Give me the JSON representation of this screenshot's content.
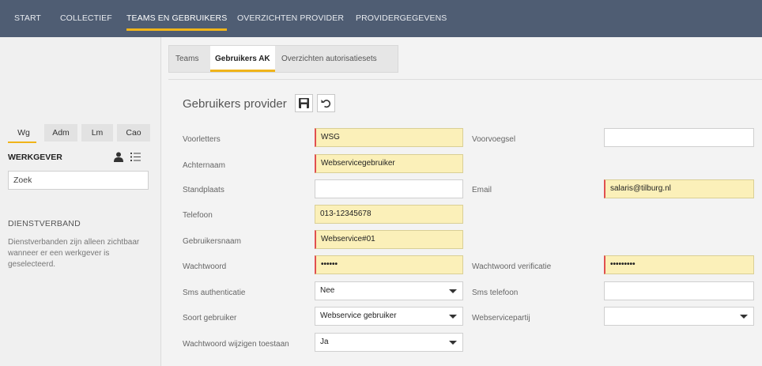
{
  "nav": [
    "START",
    "COLLECTIEF",
    "TEAMS EN GEBRUIKERS",
    "OVERZICHTEN PROVIDER",
    "PROVIDERGEGEVENS"
  ],
  "sidebar": {
    "tabs": [
      "Wg",
      "Adm",
      "Lm",
      "Cao"
    ],
    "heading": "WERKGEVER",
    "search_value": "Zoek",
    "section_heading": "DIENSTVERBAND",
    "note": "Dienstverbanden zijn alleen zichtbaar wanneer er een werkgever is geselecteerd."
  },
  "subtabs": [
    "Teams",
    "Gebruikers AK",
    "Overzichten autorisatiesets"
  ],
  "form": {
    "title": "Gebruikers provider",
    "fields": {
      "voorletters": {
        "label": "Voorletters",
        "value": "WSG"
      },
      "voorvoegsel": {
        "label": "Voorvoegsel",
        "value": ""
      },
      "achternaam": {
        "label": "Achternaam",
        "value": "Webservicegebruiker"
      },
      "standplaats": {
        "label": "Standplaats",
        "value": ""
      },
      "email": {
        "label": "Email",
        "value": "salaris@tilburg.nl"
      },
      "telefoon": {
        "label": "Telefoon",
        "value": "013-12345678"
      },
      "gebruikersnaam": {
        "label": "Gebruikersnaam",
        "value": "Webservice#01"
      },
      "wachtwoord": {
        "label": "Wachtwoord",
        "value": "••••••"
      },
      "wachtwoord_verificatie": {
        "label": "Wachtwoord verificatie",
        "value": "•••••••••"
      },
      "sms_authenticatie": {
        "label": "Sms authenticatie",
        "value": "Nee"
      },
      "sms_telefoon": {
        "label": "Sms telefoon",
        "value": ""
      },
      "soort_gebruiker": {
        "label": "Soort gebruiker",
        "value": "Webservice gebruiker"
      },
      "webservicepartij": {
        "label": "Webservicepartij",
        "value": ""
      },
      "wachtwoord_wijzigen": {
        "label": "Wachtwoord wijzigen toestaan",
        "value": "Ja"
      }
    }
  },
  "colors": {
    "nav_bg": "#4f5d73",
    "accent": "#f0b41a",
    "required_bg": "#fbf0b9",
    "required_marker": "#e05050"
  },
  "icons": [
    "person-icon",
    "list-icon",
    "save-icon",
    "undo-icon",
    "caret-down-icon"
  ]
}
